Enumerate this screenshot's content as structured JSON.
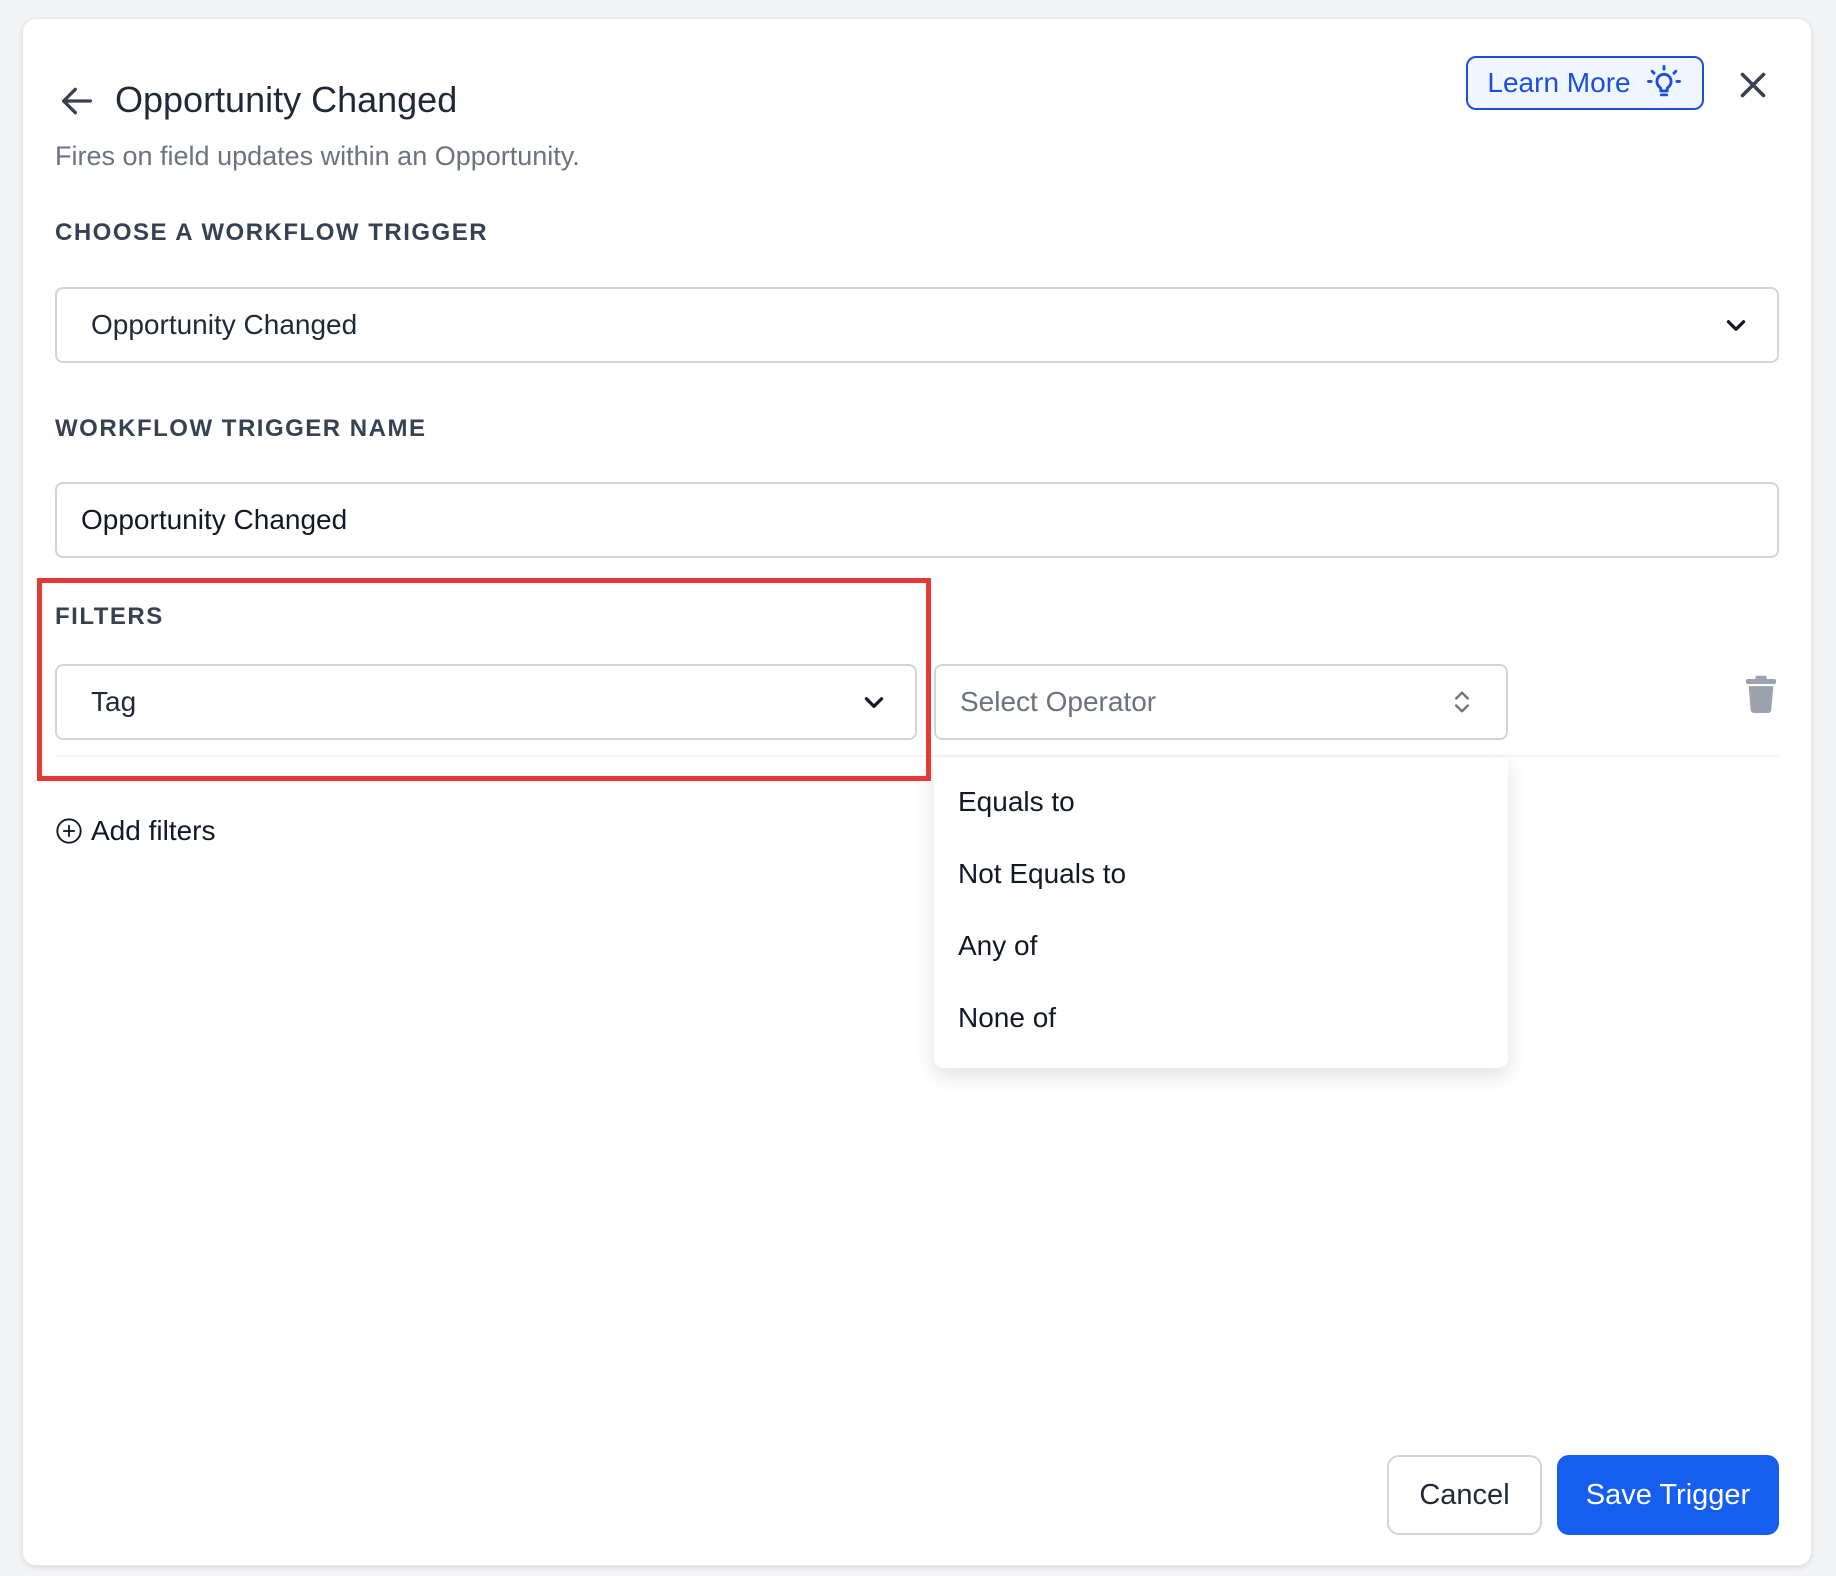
{
  "header": {
    "title": "Opportunity Changed",
    "subtitle": "Fires on field updates within an Opportunity.",
    "learn_more_label": "Learn More"
  },
  "trigger_section": {
    "label": "CHOOSE A WORKFLOW TRIGGER",
    "selected_value": "Opportunity Changed"
  },
  "name_section": {
    "label": "WORKFLOW TRIGGER NAME",
    "value": "Opportunity Changed"
  },
  "filters_section": {
    "label": "FILTERS",
    "filter_field_value": "Tag",
    "operator_placeholder": "Select Operator",
    "operator_options": [
      "Equals to",
      "Not Equals to",
      "Any of",
      "None of"
    ],
    "add_filters_label": "Add filters"
  },
  "footer": {
    "cancel_label": "Cancel",
    "save_label": "Save Trigger"
  },
  "colors": {
    "primary": "#155eef",
    "highlight": "#e53935",
    "link": "#1d4ed8"
  },
  "icons": [
    "arrow-left-icon",
    "lightbulb-icon",
    "close-icon",
    "chevron-down-icon",
    "chevron-up-down-icon",
    "trash-icon",
    "plus-circle-icon"
  ]
}
